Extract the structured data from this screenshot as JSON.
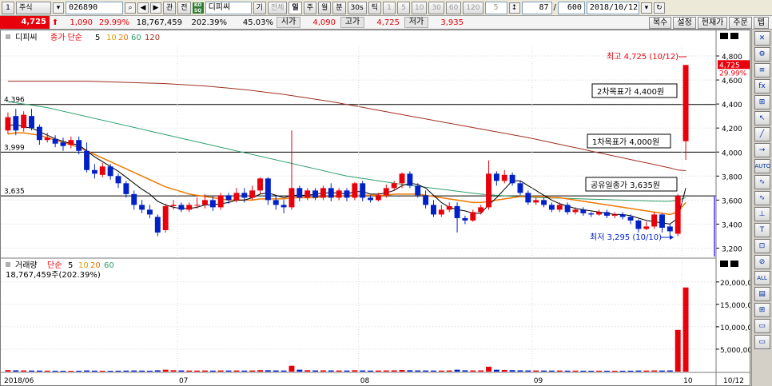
{
  "toolbar": {
    "period_num": "1",
    "period_unit": "주식",
    "code": "026890",
    "nav_prev": "◀",
    "nav_next": "▶",
    "link1": "관",
    "link2": "전",
    "company": "디피씨",
    "period_buttons": [
      "기",
      "전체",
      "일",
      "주",
      "월",
      "분",
      "30s",
      "틱",
      "1",
      "5",
      "10",
      "30",
      "60",
      "120",
      "5"
    ],
    "count_value": "87",
    "count_sep": "/",
    "total_value": "600",
    "date_value": "2018/10/12"
  },
  "quote": {
    "price": "4,725",
    "change": "1,090",
    "change_rate": "29.99%",
    "volume": "18,767,459",
    "volume_rate": "202.39%",
    "turnover": "45.03%",
    "open_label": "시가",
    "open": "4,090",
    "high_label": "고가",
    "high": "4,725",
    "low_label": "저가",
    "low": "3,935",
    "buttons": [
      "복수",
      "설정",
      "현재가",
      "주문",
      "텝"
    ]
  },
  "price_panel": {
    "name": "디피씨",
    "ma_label": "종가 단순",
    "ma_periods": [
      "5",
      "10",
      "20",
      "60",
      "120"
    ],
    "ma_colors": [
      "#000000",
      "#e0a000",
      "#f07800",
      "#2e9e6e",
      "#a03020"
    ],
    "y_ticks": [
      "4,800",
      "4,600",
      "4,400",
      "4,200",
      "4,000",
      "3,800",
      "3,600",
      "3,400",
      "3,200"
    ],
    "current_tag": "4,725",
    "current_rate": "29.99%",
    "level_labels": [
      "4,396",
      "3,999",
      "3,635"
    ],
    "annotations": {
      "high": "최고 4,725 (10/12)",
      "target2": "2차목표가 4,400원",
      "target1": "1차목표가 4,000원",
      "offering": "공유일종가 3,635원",
      "low": "최저 3,295 (10/10)"
    }
  },
  "volume_panel": {
    "name": "거래량",
    "ma_label": "단순",
    "ma_periods": [
      "5",
      "10",
      "20",
      "60"
    ],
    "value": "18,767,459주(202.39%)",
    "y_ticks": [
      "20,000,0",
      "15,000,0",
      "10,000,0",
      "5,000,00"
    ]
  },
  "x_axis": {
    "labels": [
      "2018/06",
      "07",
      "08",
      "09",
      "10",
      "10/12"
    ]
  },
  "sidebar": {
    "items": [
      "✕",
      "⚙",
      "≡",
      "fx",
      "⊞",
      "↖",
      "╱",
      "→",
      "AUTO",
      "∿",
      "∿",
      "⊥",
      "T",
      "⊡",
      "⊘",
      "ALL",
      "▤",
      "⊞",
      "▭",
      "▭"
    ]
  },
  "colors": {
    "up": "#e8000b",
    "down": "#0020c8",
    "accent": "#0030a0"
  },
  "chart_data": {
    "type": "candlestick",
    "title": "디피씨",
    "ylim": [
      3150,
      4880
    ],
    "volume_ylim": [
      0,
      20500000
    ],
    "reference_lines": [
      4396,
      3999,
      3635
    ],
    "candles": [
      {
        "o": 4180,
        "c": 4290,
        "h": 4330,
        "l": 4150
      },
      {
        "o": 4300,
        "c": 4180,
        "h": 4360,
        "l": 4140
      },
      {
        "o": 4200,
        "c": 4310,
        "h": 4340,
        "l": 4170
      },
      {
        "o": 4300,
        "c": 4200,
        "h": 4360,
        "l": 4180
      },
      {
        "o": 4210,
        "c": 4100,
        "h": 4230,
        "l": 4060
      },
      {
        "o": 4100,
        "c": 4120,
        "h": 4160,
        "l": 4080
      },
      {
        "o": 4110,
        "c": 4070,
        "h": 4140,
        "l": 4040
      },
      {
        "o": 4080,
        "c": 4050,
        "h": 4120,
        "l": 4010
      },
      {
        "o": 4060,
        "c": 4100,
        "h": 4130,
        "l": 4030
      },
      {
        "o": 4100,
        "c": 4010,
        "h": 4130,
        "l": 3980
      },
      {
        "o": 4010,
        "c": 3850,
        "h": 4080,
        "l": 3830
      },
      {
        "o": 3850,
        "c": 3820,
        "h": 3900,
        "l": 3780
      },
      {
        "o": 3810,
        "c": 3880,
        "h": 3910,
        "l": 3790
      },
      {
        "o": 3880,
        "c": 3800,
        "h": 3900,
        "l": 3770
      },
      {
        "o": 3800,
        "c": 3740,
        "h": 3820,
        "l": 3700
      },
      {
        "o": 3740,
        "c": 3650,
        "h": 3760,
        "l": 3620
      },
      {
        "o": 3650,
        "c": 3560,
        "h": 3680,
        "l": 3520
      },
      {
        "o": 3560,
        "c": 3520,
        "h": 3600,
        "l": 3490
      },
      {
        "o": 3520,
        "c": 3480,
        "h": 3560,
        "l": 3450
      },
      {
        "o": 3460,
        "c": 3330,
        "h": 3480,
        "l": 3300
      },
      {
        "o": 3350,
        "c": 3550,
        "h": 3570,
        "l": 3330
      },
      {
        "o": 3550,
        "c": 3560,
        "h": 3600,
        "l": 3520
      },
      {
        "o": 3560,
        "c": 3520,
        "h": 3580,
        "l": 3500
      },
      {
        "o": 3520,
        "c": 3560,
        "h": 3580,
        "l": 3500
      },
      {
        "o": 3560,
        "c": 3560,
        "h": 3620,
        "l": 3530
      },
      {
        "o": 3560,
        "c": 3600,
        "h": 3650,
        "l": 3530
      },
      {
        "o": 3600,
        "c": 3540,
        "h": 3630,
        "l": 3510
      },
      {
        "o": 3540,
        "c": 3640,
        "h": 3660,
        "l": 3520
      },
      {
        "o": 3640,
        "c": 3600,
        "h": 3660,
        "l": 3570
      },
      {
        "o": 3600,
        "c": 3660,
        "h": 3700,
        "l": 3580
      },
      {
        "o": 3660,
        "c": 3620,
        "h": 3700,
        "l": 3580
      },
      {
        "o": 3620,
        "c": 3680,
        "h": 3720,
        "l": 3600
      },
      {
        "o": 3680,
        "c": 3780,
        "h": 3790,
        "l": 3650
      },
      {
        "o": 3780,
        "c": 3600,
        "h": 3790,
        "l": 3560
      },
      {
        "o": 3600,
        "c": 3560,
        "h": 3640,
        "l": 3520
      },
      {
        "o": 3560,
        "c": 3540,
        "h": 3600,
        "l": 3490
      },
      {
        "o": 3540,
        "c": 3700,
        "h": 4180,
        "l": 3520
      },
      {
        "o": 3700,
        "c": 3620,
        "h": 3720,
        "l": 3590
      },
      {
        "o": 3620,
        "c": 3680,
        "h": 3700,
        "l": 3600
      },
      {
        "o": 3680,
        "c": 3620,
        "h": 3700,
        "l": 3600
      },
      {
        "o": 3620,
        "c": 3700,
        "h": 3720,
        "l": 3600
      },
      {
        "o": 3700,
        "c": 3620,
        "h": 3740,
        "l": 3590
      },
      {
        "o": 3620,
        "c": 3680,
        "h": 3700,
        "l": 3600
      },
      {
        "o": 3680,
        "c": 3620,
        "h": 3700,
        "l": 3590
      },
      {
        "o": 3620,
        "c": 3740,
        "h": 3750,
        "l": 3600
      },
      {
        "o": 3740,
        "c": 3620,
        "h": 3760,
        "l": 3590
      },
      {
        "o": 3620,
        "c": 3600,
        "h": 3640,
        "l": 3580
      },
      {
        "o": 3600,
        "c": 3640,
        "h": 3660,
        "l": 3590
      },
      {
        "o": 3640,
        "c": 3700,
        "h": 3730,
        "l": 3620
      },
      {
        "o": 3700,
        "c": 3740,
        "h": 3760,
        "l": 3680
      },
      {
        "o": 3740,
        "c": 3820,
        "h": 3830,
        "l": 3700
      },
      {
        "o": 3820,
        "c": 3720,
        "h": 3840,
        "l": 3700
      },
      {
        "o": 3720,
        "c": 3640,
        "h": 3740,
        "l": 3620
      },
      {
        "o": 3640,
        "c": 3560,
        "h": 3680,
        "l": 3530
      },
      {
        "o": 3560,
        "c": 3480,
        "h": 3600,
        "l": 3460
      },
      {
        "o": 3480,
        "c": 3520,
        "h": 3560,
        "l": 3460
      },
      {
        "o": 3520,
        "c": 3550,
        "h": 3580,
        "l": 3500
      },
      {
        "o": 3550,
        "c": 3450,
        "h": 3580,
        "l": 3330
      },
      {
        "o": 3450,
        "c": 3430,
        "h": 3470,
        "l": 3400
      },
      {
        "o": 3430,
        "c": 3500,
        "h": 3520,
        "l": 3420
      },
      {
        "o": 3500,
        "c": 3540,
        "h": 3560,
        "l": 3480
      },
      {
        "o": 3540,
        "c": 3820,
        "h": 3930,
        "l": 3520
      },
      {
        "o": 3820,
        "c": 3760,
        "h": 3840,
        "l": 3720
      },
      {
        "o": 3760,
        "c": 3810,
        "h": 3850,
        "l": 3740
      },
      {
        "o": 3810,
        "c": 3740,
        "h": 3830,
        "l": 3720
      },
      {
        "o": 3740,
        "c": 3660,
        "h": 3760,
        "l": 3640
      },
      {
        "o": 3660,
        "c": 3580,
        "h": 3680,
        "l": 3560
      },
      {
        "o": 3580,
        "c": 3600,
        "h": 3620,
        "l": 3560
      },
      {
        "o": 3600,
        "c": 3560,
        "h": 3620,
        "l": 3540
      },
      {
        "o": 3560,
        "c": 3520,
        "h": 3580,
        "l": 3500
      },
      {
        "o": 3520,
        "c": 3560,
        "h": 3580,
        "l": 3500
      },
      {
        "o": 3560,
        "c": 3500,
        "h": 3580,
        "l": 3480
      },
      {
        "o": 3500,
        "c": 3520,
        "h": 3540,
        "l": 3480
      },
      {
        "o": 3520,
        "c": 3490,
        "h": 3540,
        "l": 3470
      },
      {
        "o": 3490,
        "c": 3480,
        "h": 3500,
        "l": 3460
      },
      {
        "o": 3480,
        "c": 3500,
        "h": 3520,
        "l": 3470
      },
      {
        "o": 3500,
        "c": 3470,
        "h": 3520,
        "l": 3450
      },
      {
        "o": 3470,
        "c": 3480,
        "h": 3500,
        "l": 3450
      },
      {
        "o": 3480,
        "c": 3460,
        "h": 3500,
        "l": 3440
      },
      {
        "o": 3460,
        "c": 3430,
        "h": 3480,
        "l": 3400
      },
      {
        "o": 3430,
        "c": 3360,
        "h": 3440,
        "l": 3330
      },
      {
        "o": 3360,
        "c": 3380,
        "h": 3420,
        "l": 3350
      },
      {
        "o": 3380,
        "c": 3480,
        "h": 3500,
        "l": 3360
      },
      {
        "o": 3480,
        "c": 3370,
        "h": 3490,
        "l": 3330
      },
      {
        "o": 3380,
        "c": 3340,
        "h": 3400,
        "l": 3295
      },
      {
        "o": 3320,
        "c": 3635,
        "h": 3650,
        "l": 3300
      },
      {
        "o": 4090,
        "c": 4725,
        "h": 4725,
        "l": 3935
      }
    ],
    "volumes": [
      320000,
      280000,
      260000,
      240000,
      230000,
      210000,
      200000,
      190000,
      180000,
      200000,
      260000,
      220000,
      200000,
      190000,
      210000,
      230000,
      250000,
      230000,
      200000,
      280000,
      420000,
      300000,
      260000,
      240000,
      230000,
      250000,
      230000,
      260000,
      240000,
      250000,
      230000,
      250000,
      320000,
      300000,
      260000,
      240000,
      1300000,
      420000,
      300000,
      260000,
      280000,
      260000,
      250000,
      240000,
      300000,
      260000,
      230000,
      240000,
      260000,
      280000,
      360000,
      300000,
      260000,
      250000,
      240000,
      230000,
      250000,
      420000,
      280000,
      260000,
      270000,
      1100000,
      420000,
      360000,
      320000,
      280000,
      260000,
      250000,
      240000,
      230000,
      240000,
      220000,
      220000,
      210000,
      200000,
      210000,
      200000,
      200000,
      200000,
      210000,
      240000,
      230000,
      260000,
      240000,
      260000,
      9300000,
      18767459
    ],
    "ma_lines": {
      "ma5": [
        4220,
        4230,
        4210,
        4200,
        4170,
        4140,
        4110,
        4090,
        4070,
        4060,
        4010,
        3960,
        3920,
        3880,
        3840,
        3790,
        3740,
        3690,
        3650,
        3590,
        3560,
        3540,
        3530,
        3530,
        3540,
        3560,
        3560,
        3570,
        3580,
        3600,
        3600,
        3620,
        3650,
        3660,
        3640,
        3620,
        3640,
        3640,
        3640,
        3650,
        3660,
        3660,
        3660,
        3650,
        3670,
        3670,
        3650,
        3650,
        3660,
        3680,
        3720,
        3740,
        3730,
        3700,
        3640,
        3580,
        3540,
        3520,
        3510,
        3490,
        3490,
        3560,
        3620,
        3690,
        3760,
        3760,
        3720,
        3680,
        3640,
        3600,
        3570,
        3550,
        3530,
        3520,
        3510,
        3500,
        3490,
        3480,
        3480,
        3470,
        3450,
        3430,
        3420,
        3410,
        3400,
        3450,
        3700
      ],
      "ma20": [
        4150,
        4160,
        4160,
        4150,
        4140,
        4120,
        4100,
        4080,
        4060,
        4040,
        4010,
        3980,
        3950,
        3920,
        3890,
        3860,
        3830,
        3800,
        3770,
        3740,
        3710,
        3690,
        3670,
        3650,
        3640,
        3630,
        3620,
        3610,
        3600,
        3600,
        3600,
        3600,
        3610,
        3610,
        3610,
        3610,
        3620,
        3620,
        3620,
        3620,
        3630,
        3630,
        3630,
        3640,
        3640,
        3640,
        3640,
        3640,
        3640,
        3650,
        3650,
        3650,
        3650,
        3640,
        3630,
        3620,
        3610,
        3600,
        3590,
        3580,
        3580,
        3590,
        3600,
        3610,
        3620,
        3630,
        3630,
        3630,
        3630,
        3620,
        3620,
        3610,
        3600,
        3590,
        3580,
        3570,
        3560,
        3550,
        3540,
        3530,
        3520,
        3510,
        3500,
        3490,
        3480,
        3500,
        3580
      ],
      "ma60": [
        4420,
        4410,
        4400,
        4390,
        4380,
        4370,
        4355,
        4340,
        4325,
        4310,
        4295,
        4280,
        4265,
        4250,
        4235,
        4220,
        4205,
        4190,
        4175,
        4160,
        4145,
        4130,
        4115,
        4100,
        4085,
        4070,
        4055,
        4040,
        4025,
        4010,
        3995,
        3980,
        3965,
        3950,
        3935,
        3920,
        3905,
        3890,
        3875,
        3860,
        3845,
        3830,
        3815,
        3800,
        3790,
        3780,
        3770,
        3760,
        3750,
        3740,
        3730,
        3722,
        3714,
        3706,
        3698,
        3690,
        3682,
        3674,
        3666,
        3658,
        3650,
        3645,
        3640,
        3636,
        3632,
        3628,
        3625,
        3622,
        3620,
        3618,
        3616,
        3614,
        3612,
        3610,
        3608,
        3606,
        3604,
        3602,
        3600,
        3598,
        3596,
        3594,
        3592,
        3590,
        3590,
        3600,
        3620
      ],
      "ma120": [
        4590,
        4590,
        4590,
        4590,
        4590,
        4590,
        4590,
        4590,
        4590,
        4590,
        4590,
        4588,
        4586,
        4584,
        4582,
        4580,
        4578,
        4576,
        4574,
        4572,
        4570,
        4566,
        4562,
        4558,
        4554,
        4550,
        4544,
        4538,
        4532,
        4526,
        4520,
        4512,
        4504,
        4496,
        4488,
        4480,
        4470,
        4460,
        4450,
        4440,
        4430,
        4420,
        4408,
        4396,
        4384,
        4372,
        4360,
        4348,
        4336,
        4324,
        4312,
        4300,
        4288,
        4276,
        4264,
        4252,
        4240,
        4228,
        4216,
        4204,
        4192,
        4180,
        4168,
        4156,
        4144,
        4132,
        4120,
        4106,
        4092,
        4078,
        4064,
        4050,
        4036,
        4022,
        4008,
        3994,
        3980,
        3966,
        3952,
        3938,
        3924,
        3910,
        3896,
        3882,
        3868,
        3850,
        3845
      ]
    }
  }
}
